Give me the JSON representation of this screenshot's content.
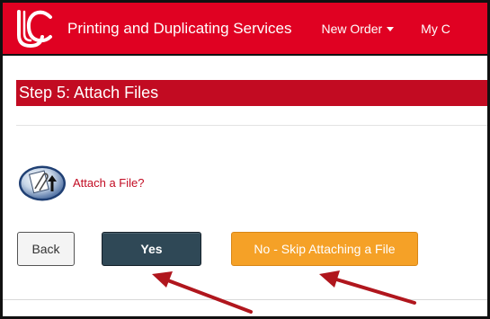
{
  "navbar": {
    "logo_text": "UC",
    "brand": "Printing and Duplicating Services",
    "new_order": "New Order",
    "my_prefix": "My C"
  },
  "step": {
    "title": "Step 5: Attach Files"
  },
  "attach": {
    "icon": "paperclip-upload-icon",
    "link_text": "Attach a File?"
  },
  "buttons": {
    "back": "Back",
    "yes": "Yes",
    "no_skip": "No - Skip Attaching a File"
  },
  "colors": {
    "brand_red": "#e00122",
    "step_red": "#c20b22",
    "yes_button": "#2f4856",
    "skip_button": "#f5a127",
    "annotation_arrow": "#b0161d"
  }
}
